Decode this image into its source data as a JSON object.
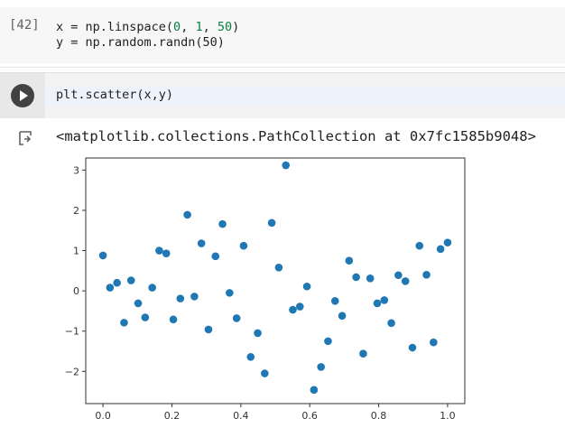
{
  "cell1": {
    "execution_count": "[42]",
    "lines": [
      {
        "pre": "x = np.linspace(",
        "a": "0",
        "s1": ", ",
        "b": "1",
        "s2": ", ",
        "c": "50",
        "post": ")"
      },
      {
        "text": "y = np.random.randn(50)"
      }
    ]
  },
  "cell2": {
    "code": "plt.scatter(x,y)"
  },
  "output": {
    "text": "<matplotlib.collections.PathCollection at 0x7fc1585b9048>"
  },
  "colors": {
    "marker": "#1f77b4",
    "number_literal": "#0b8043"
  },
  "icons": {
    "run": "play-icon",
    "output": "output-arrow-icon"
  },
  "chart_data": {
    "type": "scatter",
    "title": "",
    "xlabel": "",
    "ylabel": "",
    "xlim": [
      -0.05,
      1.05
    ],
    "ylim": [
      -2.8,
      3.3
    ],
    "xticks": [
      0.0,
      0.2,
      0.4,
      0.6,
      0.8,
      1.0
    ],
    "xtick_labels": [
      "0.0",
      "0.2",
      "0.4",
      "0.6",
      "0.8",
      "1.0"
    ],
    "yticks": [
      -2,
      -1,
      0,
      1,
      2,
      3
    ],
    "ytick_labels": [
      "−2",
      "−1",
      "0",
      "1",
      "2",
      "3"
    ],
    "grid": false,
    "x": [
      0.0,
      0.0204,
      0.0408,
      0.0612,
      0.0816,
      0.102,
      0.1224,
      0.1429,
      0.1633,
      0.1837,
      0.2041,
      0.2245,
      0.2449,
      0.2653,
      0.2857,
      0.3061,
      0.3265,
      0.3469,
      0.3673,
      0.3878,
      0.4082,
      0.4286,
      0.449,
      0.4694,
      0.4898,
      0.5102,
      0.5306,
      0.551,
      0.5714,
      0.5918,
      0.6122,
      0.6327,
      0.6531,
      0.6735,
      0.6939,
      0.7143,
      0.7347,
      0.7551,
      0.7755,
      0.7959,
      0.8163,
      0.8367,
      0.8571,
      0.8776,
      0.898,
      0.9184,
      0.9388,
      0.9592,
      0.9796,
      1.0
    ],
    "y": [
      0.88,
      0.08,
      0.2,
      -0.79,
      0.26,
      -0.31,
      -0.66,
      0.08,
      1.0,
      0.93,
      -0.71,
      -0.19,
      1.89,
      -0.14,
      1.18,
      -0.96,
      0.86,
      1.66,
      -0.05,
      -0.68,
      1.12,
      -1.64,
      -1.05,
      -2.05,
      1.69,
      0.58,
      3.12,
      -0.47,
      -0.39,
      0.11,
      -2.46,
      -1.89,
      -1.25,
      -0.25,
      -0.62,
      0.75,
      0.34,
      -1.56,
      0.31,
      -0.31,
      -0.23,
      -0.8,
      0.39,
      0.24,
      -1.41,
      1.12,
      0.4,
      -1.28,
      1.04,
      1.2
    ]
  }
}
